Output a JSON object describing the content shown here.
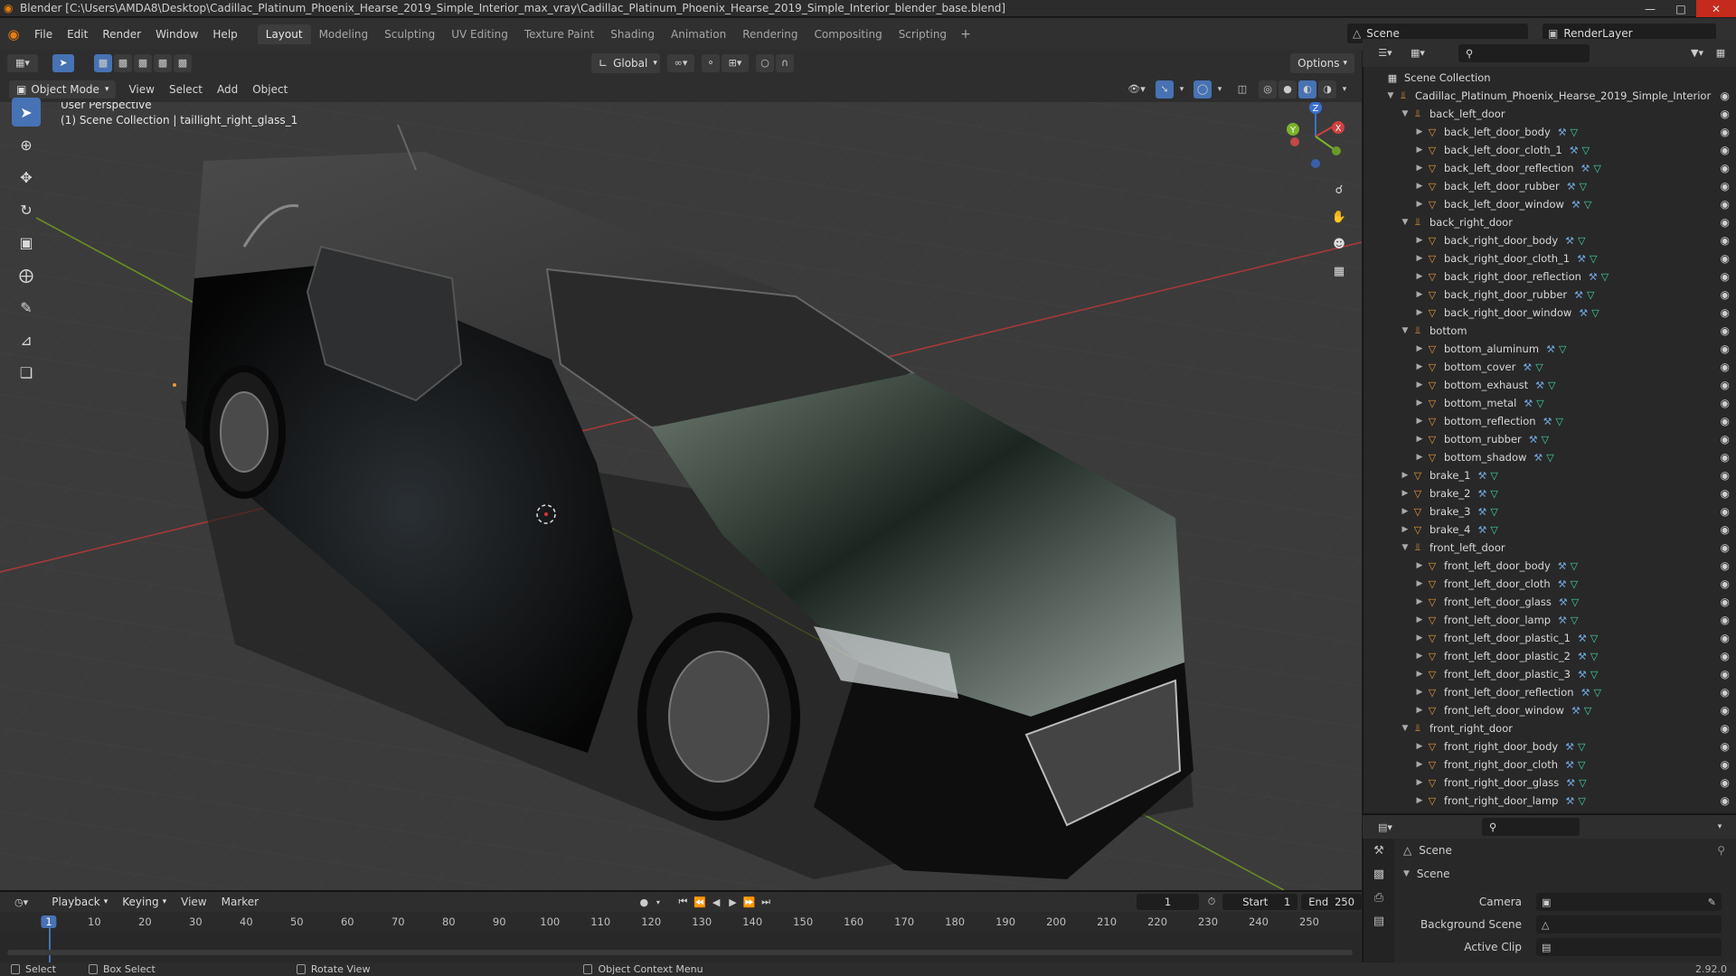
{
  "window": {
    "title": "Blender [C:\\Users\\AMDA8\\Desktop\\Cadillac_Platinum_Phoenix_Hearse_2019_Simple_Interior_max_vray\\Cadillac_Platinum_Phoenix_Hearse_2019_Simple_Interior_blender_base.blend]",
    "minimize": "—",
    "maximize": "□",
    "close": "✕"
  },
  "menu": [
    "File",
    "Edit",
    "Render",
    "Window",
    "Help"
  ],
  "workspaces": {
    "tabs": [
      "Layout",
      "Modeling",
      "Sculpting",
      "UV Editing",
      "Texture Paint",
      "Shading",
      "Animation",
      "Rendering",
      "Compositing",
      "Scripting"
    ],
    "active": "Layout",
    "add": "+"
  },
  "scene_selector": {
    "value": "Scene"
  },
  "renderlayer_selector": {
    "value": "RenderLayer"
  },
  "viewport_header": {
    "transform_orientation": "Global",
    "options_label": "Options",
    "mode": "Object Mode",
    "menus": [
      "View",
      "Select",
      "Add",
      "Object"
    ]
  },
  "viewport": {
    "perspective_label": "User Perspective",
    "context_label": "(1) Scene Collection | taillight_right_glass_1",
    "gizmo": {
      "x": "X",
      "y": "Y",
      "z": "Z"
    }
  },
  "outliner": {
    "root": "Scene Collection",
    "rows": [
      {
        "label": "Cadillac_Platinum_Phoenix_Hearse_2019_Simple_Interior",
        "level": 1,
        "type": "empty",
        "open": true
      },
      {
        "label": "back_left_door",
        "level": 2,
        "type": "empty",
        "open": true
      },
      {
        "label": "back_left_door_body",
        "level": 3,
        "type": "mesh"
      },
      {
        "label": "back_left_door_cloth_1",
        "level": 3,
        "type": "mesh"
      },
      {
        "label": "back_left_door_reflection",
        "level": 3,
        "type": "mesh"
      },
      {
        "label": "back_left_door_rubber",
        "level": 3,
        "type": "mesh"
      },
      {
        "label": "back_left_door_window",
        "level": 3,
        "type": "mesh"
      },
      {
        "label": "back_right_door",
        "level": 2,
        "type": "empty",
        "open": true
      },
      {
        "label": "back_right_door_body",
        "level": 3,
        "type": "mesh"
      },
      {
        "label": "back_right_door_cloth_1",
        "level": 3,
        "type": "mesh"
      },
      {
        "label": "back_right_door_reflection",
        "level": 3,
        "type": "mesh"
      },
      {
        "label": "back_right_door_rubber",
        "level": 3,
        "type": "mesh"
      },
      {
        "label": "back_right_door_window",
        "level": 3,
        "type": "mesh"
      },
      {
        "label": "bottom",
        "level": 2,
        "type": "empty",
        "open": true
      },
      {
        "label": "bottom_aluminum",
        "level": 3,
        "type": "mesh"
      },
      {
        "label": "bottom_cover",
        "level": 3,
        "type": "mesh"
      },
      {
        "label": "bottom_exhaust",
        "level": 3,
        "type": "mesh"
      },
      {
        "label": "bottom_metal",
        "level": 3,
        "type": "mesh"
      },
      {
        "label": "bottom_reflection",
        "level": 3,
        "type": "mesh"
      },
      {
        "label": "bottom_rubber",
        "level": 3,
        "type": "mesh"
      },
      {
        "label": "bottom_shadow",
        "level": 3,
        "type": "mesh"
      },
      {
        "label": "brake_1",
        "level": 2,
        "type": "mesh"
      },
      {
        "label": "brake_2",
        "level": 2,
        "type": "mesh"
      },
      {
        "label": "brake_3",
        "level": 2,
        "type": "mesh"
      },
      {
        "label": "brake_4",
        "level": 2,
        "type": "mesh"
      },
      {
        "label": "front_left_door",
        "level": 2,
        "type": "empty",
        "open": true
      },
      {
        "label": "front_left_door_body",
        "level": 3,
        "type": "mesh"
      },
      {
        "label": "front_left_door_cloth",
        "level": 3,
        "type": "mesh"
      },
      {
        "label": "front_left_door_glass",
        "level": 3,
        "type": "mesh"
      },
      {
        "label": "front_left_door_lamp",
        "level": 3,
        "type": "mesh"
      },
      {
        "label": "front_left_door_plastic_1",
        "level": 3,
        "type": "mesh"
      },
      {
        "label": "front_left_door_plastic_2",
        "level": 3,
        "type": "mesh"
      },
      {
        "label": "front_left_door_plastic_3",
        "level": 3,
        "type": "mesh"
      },
      {
        "label": "front_left_door_reflection",
        "level": 3,
        "type": "mesh"
      },
      {
        "label": "front_left_door_window",
        "level": 3,
        "type": "mesh"
      },
      {
        "label": "front_right_door",
        "level": 2,
        "type": "empty",
        "open": true
      },
      {
        "label": "front_right_door_body",
        "level": 3,
        "type": "mesh"
      },
      {
        "label": "front_right_door_cloth",
        "level": 3,
        "type": "mesh"
      },
      {
        "label": "front_right_door_glass",
        "level": 3,
        "type": "mesh"
      },
      {
        "label": "front_right_door_lamp",
        "level": 3,
        "type": "mesh"
      }
    ]
  },
  "properties": {
    "breadcrumb": "Scene",
    "panel_title": "Scene",
    "fields": [
      {
        "label": "Camera"
      },
      {
        "label": "Background Scene"
      },
      {
        "label": "Active Clip"
      }
    ]
  },
  "timeline": {
    "menus": [
      "Playback",
      "Keying",
      "View",
      "Marker"
    ],
    "current_frame": "1",
    "start_label": "Start",
    "start": "1",
    "end_label": "End",
    "end": "250",
    "ticks": [
      "1",
      "10",
      "20",
      "30",
      "40",
      "50",
      "60",
      "70",
      "80",
      "90",
      "100",
      "110",
      "120",
      "130",
      "140",
      "150",
      "160",
      "170",
      "180",
      "190",
      "200",
      "210",
      "220",
      "230",
      "240",
      "250"
    ]
  },
  "statusbar": {
    "select": "Select",
    "box_select": "Box Select",
    "rotate_view": "Rotate View",
    "context_menu": "Object Context Menu",
    "version": "2.92.0"
  },
  "colors": {
    "accent": "#4772b3",
    "blender_orange": "#e87d0d",
    "mesh_green": "#3fd6a5"
  }
}
